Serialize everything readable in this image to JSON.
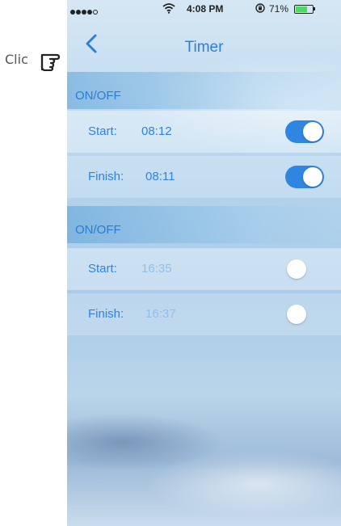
{
  "annotation": {
    "text": "Clic"
  },
  "status_bar": {
    "signal_dots": 5,
    "time": "4:08 PM",
    "battery_percent": "71%",
    "battery_level": 0.71
  },
  "navbar": {
    "title": "Timer"
  },
  "timers": [
    {
      "header": "ON/OFF",
      "start_label": "Start:",
      "start_time": "08:12",
      "start_enabled": true,
      "finish_label": "Finish:",
      "finish_time": "08:11",
      "finish_enabled": true
    },
    {
      "header": "ON/OFF",
      "start_label": "Start:",
      "start_time": "16:35",
      "start_enabled": false,
      "finish_label": "Finish:",
      "finish_time": "16:37",
      "finish_enabled": false
    }
  ],
  "colors": {
    "accent": "#2f84dc",
    "dim_value": "#8fbfea",
    "toggle_on": "#2f86e0"
  }
}
